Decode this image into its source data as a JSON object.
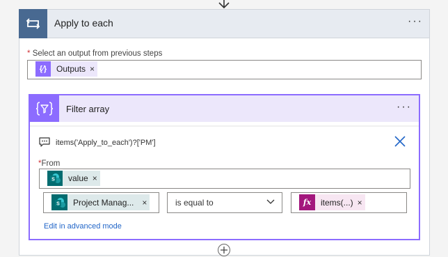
{
  "apply_to_each": {
    "title": "Apply to each",
    "more": "···",
    "select_label_required": "*",
    "select_label": "Select an output from previous steps",
    "outputs_token": {
      "icon_glyph": "{∕}",
      "label": "Outputs",
      "remove": "×"
    }
  },
  "filter_array": {
    "title": "Filter array",
    "more": "···",
    "comment": "items('Apply_to_each')?['PM']",
    "from_label_required": "*",
    "from_label": "From",
    "value_token": {
      "label": "value",
      "remove": "×"
    },
    "condition": {
      "left_token": {
        "label": "Project Manag...",
        "remove": "×"
      },
      "operator": "is equal to",
      "right_token": {
        "icon_glyph": "fx",
        "label": "items(...)",
        "remove": "×"
      }
    },
    "advanced_link": "Edit in advanced mode"
  },
  "colors": {
    "loop_accent": "#486991",
    "filter_accent": "#8c6cff",
    "sharepoint": "#036c70",
    "expression": "#a3177d",
    "link": "#2266c8"
  },
  "icons": {
    "connector_arrow": "arrow-down-icon",
    "loop": "loop-icon",
    "variable": "variable-icon",
    "filter": "filter-icon",
    "comment": "comment-icon",
    "close": "close-icon",
    "sharepoint": "sharepoint-icon",
    "expression": "fx-icon",
    "chevron": "chevron-down-icon",
    "add": "add-step-icon"
  }
}
